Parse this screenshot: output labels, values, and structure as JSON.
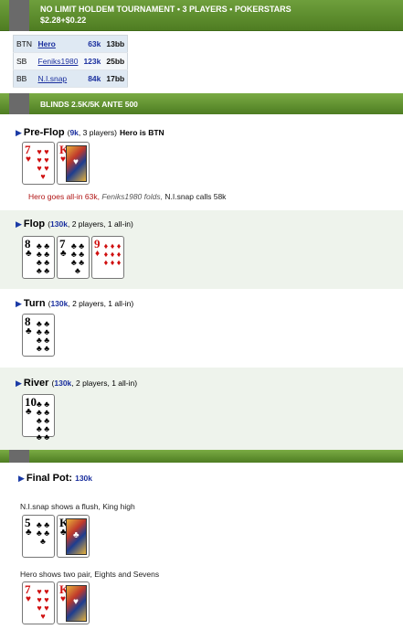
{
  "header": {
    "title": "NO LIMIT HOLDEM TOURNAMENT • 3 PLAYERS • POKERSTARS",
    "buyin": "$2.28+$0.22"
  },
  "players": [
    {
      "pos": "BTN",
      "name": "Hero",
      "stack": "63k",
      "bb": "13bb"
    },
    {
      "pos": "SB",
      "name": "Feniks1980",
      "stack": "123k",
      "bb": "25bb"
    },
    {
      "pos": "BB",
      "name": "N.I.snap",
      "stack": "84k",
      "bb": "17bb"
    }
  ],
  "blinds": "BLINDS 2.5K/5K ANTE 500",
  "preflop": {
    "title": "Pre-Flop",
    "pot": "9k",
    "info": ", 3 players)",
    "hero_tag": "Hero is BTN",
    "cards": [
      {
        "rank": "7",
        "suit": "♥",
        "color": "red"
      },
      {
        "rank": "K",
        "suit": "♥",
        "color": "red"
      }
    ],
    "actions": {
      "a1": "Hero goes all-in 63k,",
      "a2": "Feniks1980 folds,",
      "a3": "N.I.snap calls 58k"
    }
  },
  "flop": {
    "title": "Flop",
    "pot": "130k",
    "info": ", 2 players, 1 all-in)",
    "cards": [
      {
        "rank": "8",
        "suit": "♣",
        "color": "blk"
      },
      {
        "rank": "7",
        "suit": "♣",
        "color": "blk"
      },
      {
        "rank": "9",
        "suit": "♦",
        "color": "red"
      }
    ]
  },
  "turn": {
    "title": "Turn",
    "pot": "130k",
    "info": ", 2 players, 1 all-in)",
    "cards": [
      {
        "rank": "8",
        "suit": "♣",
        "color": "blk"
      }
    ]
  },
  "river": {
    "title": "River",
    "pot": "130k",
    "info": ", 2 players, 1 all-in)",
    "cards": [
      {
        "rank": "10",
        "suit": "♣",
        "color": "blk"
      }
    ]
  },
  "final": {
    "title": "Final Pot:",
    "pot": "130k",
    "show1": "N.I.snap shows a flush, King high",
    "cards1": [
      {
        "rank": "5",
        "suit": "♣",
        "color": "blk"
      },
      {
        "rank": "K",
        "suit": "♣",
        "color": "blk"
      }
    ],
    "show2": "Hero shows two pair, Eights and Sevens",
    "cards2": [
      {
        "rank": "7",
        "suit": "♥",
        "color": "red"
      },
      {
        "rank": "K",
        "suit": "♥",
        "color": "red"
      }
    ]
  },
  "colors": {
    "header_green": "#5a8a2c",
    "link_blue": "#1a2f9e",
    "action_red": "#b01414"
  }
}
